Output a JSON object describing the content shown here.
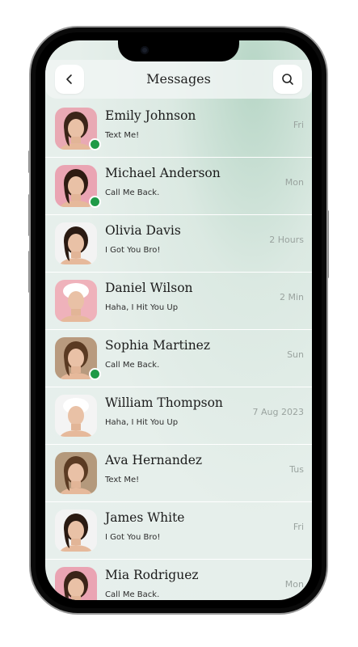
{
  "header": {
    "title": "Messages",
    "back_icon": "chevron-left-icon",
    "search_icon": "search-icon"
  },
  "colors": {
    "online": "#1f9a47",
    "screen_bg": "#e6efeb",
    "accent_glow": "#b7d6c6"
  },
  "conversations": [
    {
      "name": "Emily Johnson",
      "message": "Text Me!",
      "time": "Fri",
      "online": true,
      "avatar_bg": "#e9a9b4"
    },
    {
      "name": "Michael Anderson",
      "message": "Call Me Back.",
      "time": "Mon",
      "online": true,
      "avatar_bg": "#eaa4b3"
    },
    {
      "name": "Olivia Davis",
      "message": "I Got You Bro!",
      "time": "2 Hours",
      "online": false,
      "avatar_bg": "#f3f3f3"
    },
    {
      "name": "Daniel Wilson",
      "message": "Haha, I Hit You Up",
      "time": "2 Min",
      "online": false,
      "avatar_bg": "#efb2bb"
    },
    {
      "name": "Sophia Martinez",
      "message": "Call Me Back.",
      "time": "Sun",
      "online": true,
      "avatar_bg": "#b89a7e"
    },
    {
      "name": "William Thompson",
      "message": "Haha, I Hit You Up",
      "time": "7 Aug 2023",
      "online": false,
      "avatar_bg": "#f4f4f4"
    },
    {
      "name": "Ava Hernandez",
      "message": "Text Me!",
      "time": "Tus",
      "online": false,
      "avatar_bg": "#b4997c"
    },
    {
      "name": "James White",
      "message": "I Got You Bro!",
      "time": "Fri",
      "online": false,
      "avatar_bg": "#f3f3f3"
    },
    {
      "name": "Mia Rodriguez",
      "message": "Call Me Back.",
      "time": "Mon",
      "online": false,
      "avatar_bg": "#eaa4b3"
    }
  ]
}
